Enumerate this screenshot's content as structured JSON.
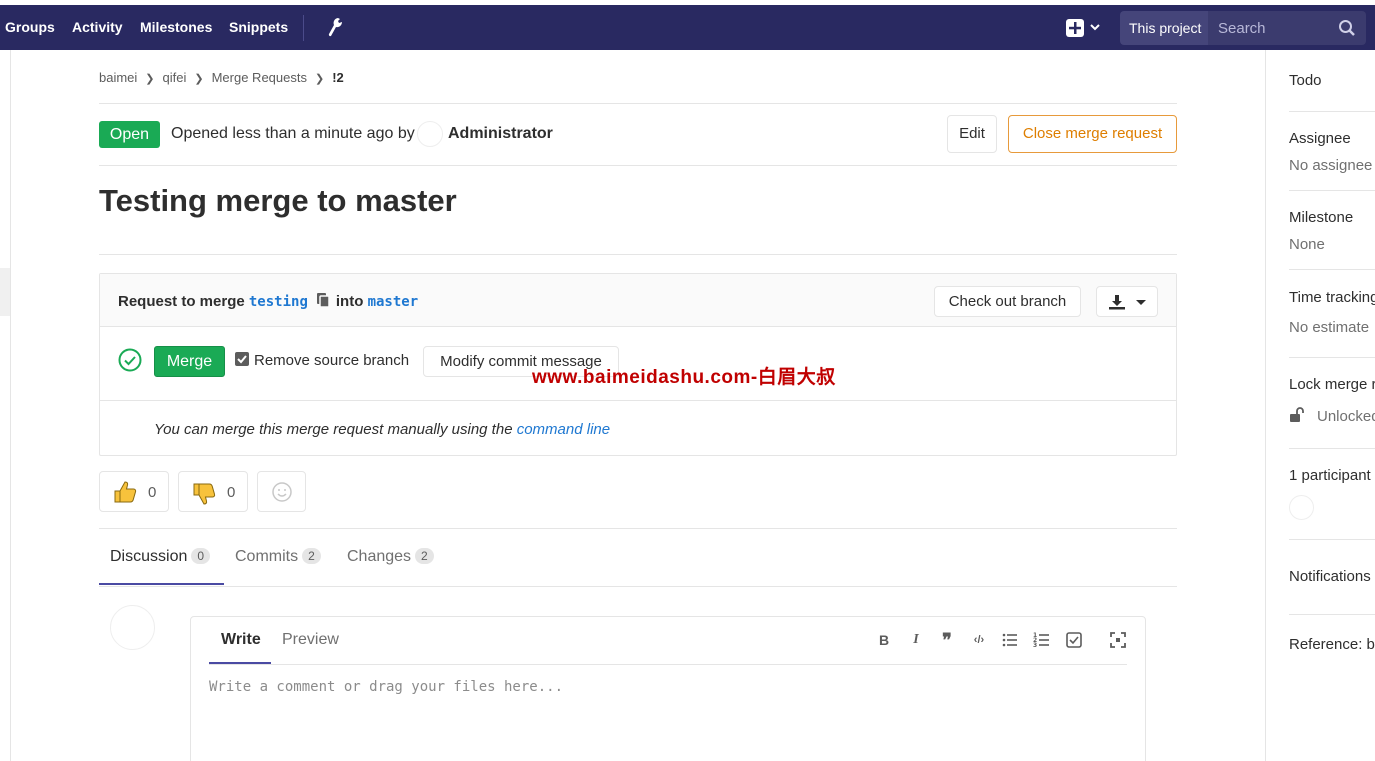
{
  "nav": {
    "groups": "Groups",
    "activity": "Activity",
    "milestones": "Milestones",
    "snippets": "Snippets",
    "scope": "This project",
    "search_placeholder": "Search"
  },
  "breadcrumb": {
    "items": [
      "baimei",
      "qifei",
      "Merge Requests",
      "!2"
    ]
  },
  "mr": {
    "status": "Open",
    "opened_text": "Opened less than a minute ago by",
    "author": "Administrator",
    "edit_label": "Edit",
    "close_label": "Close merge request",
    "title": "Testing merge to master"
  },
  "widget": {
    "request_to_merge": "Request to merge",
    "source_branch": "testing",
    "into": "into",
    "target_branch": "master",
    "checkout_label": "Check out branch",
    "merge_label": "Merge",
    "remove_source_label": "Remove source branch",
    "remove_source_checked": true,
    "modify_commit_label": "Modify commit message",
    "manual_text": "You can merge this merge request manually using the",
    "command_line_link": "command line"
  },
  "watermark": "www.baimeidashu.com-白眉大叔",
  "awards": {
    "thumbs_up": "0",
    "thumbs_down": "0"
  },
  "tabs": [
    {
      "label": "Discussion",
      "count": "0"
    },
    {
      "label": "Commits",
      "count": "2"
    },
    {
      "label": "Changes",
      "count": "2"
    }
  ],
  "comment": {
    "write_tab": "Write",
    "preview_tab": "Preview",
    "placeholder": "Write a comment or drag your files here...",
    "toolbar_icons": [
      "bold-icon",
      "italic-icon",
      "quote-icon",
      "code-icon",
      "bullet-list-icon",
      "numbered-list-icon",
      "task-list-icon",
      "fullscreen-icon"
    ]
  },
  "sidebar": {
    "todo": "Todo",
    "assignee_title": "Assignee",
    "assignee_value": "No assignee",
    "milestone_title": "Milestone",
    "milestone_value": "None",
    "time_tracking_title": "Time tracking",
    "time_tracking_value": "No estimate",
    "lock_title": "Lock merge r",
    "lock_value": "Unlocked",
    "participants": "1 participant",
    "notifications": "Notifications",
    "reference": "Reference: ba"
  },
  "colors": {
    "navbar": "#292961",
    "open_badge": "#1aaa55",
    "close_button": "#de7e00",
    "link": "#1f78d1",
    "watermark": "#c00000"
  }
}
